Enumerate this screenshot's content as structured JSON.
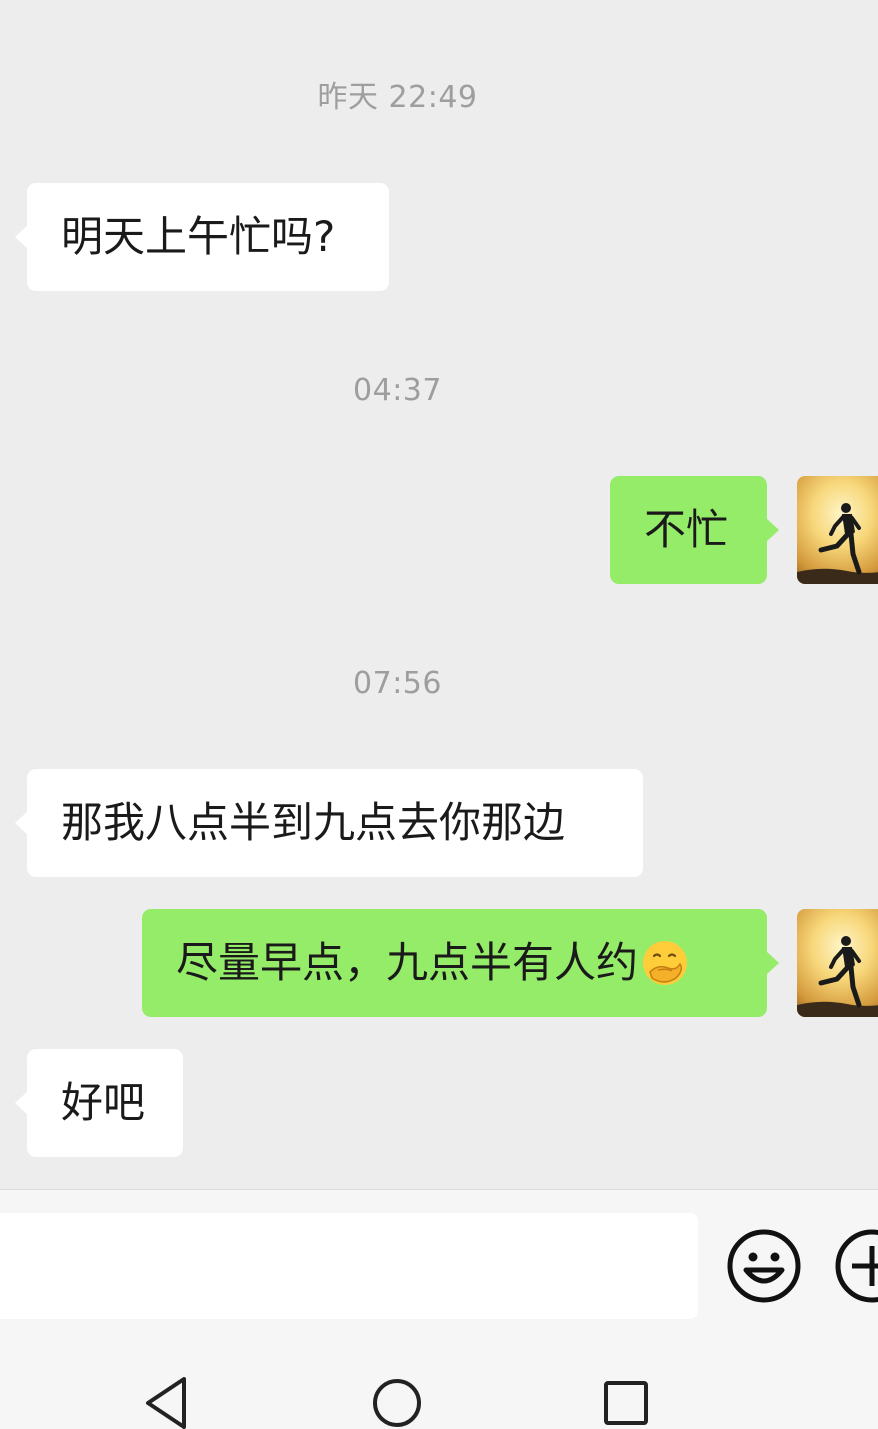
{
  "chat": {
    "timestamps": [
      "昨天 22:49",
      "04:37",
      "07:56"
    ],
    "messages": [
      {
        "from": "other",
        "text": "明天上午忙吗?"
      },
      {
        "from": "me",
        "text": "不忙"
      },
      {
        "from": "other",
        "text": "那我八点半到九点去你那边"
      },
      {
        "from": "me",
        "text": "尽量早点，九点半有人约",
        "emoji": "face-with-hand-over-mouth"
      },
      {
        "from": "other",
        "text": "好吧"
      }
    ]
  },
  "composer": {
    "input_value": "",
    "emoji_icon": "smiley-face-icon",
    "more_icon": "plus-circle-icon"
  },
  "navigation": {
    "back_icon": "triangle-back-icon",
    "home_icon": "circle-home-icon",
    "recents_icon": "square-recents-icon"
  },
  "colors": {
    "background": "#ededed",
    "incoming_bubble": "#ffffff",
    "outgoing_bubble": "#95ec69",
    "timestamp_text": "#9e9e9e"
  }
}
